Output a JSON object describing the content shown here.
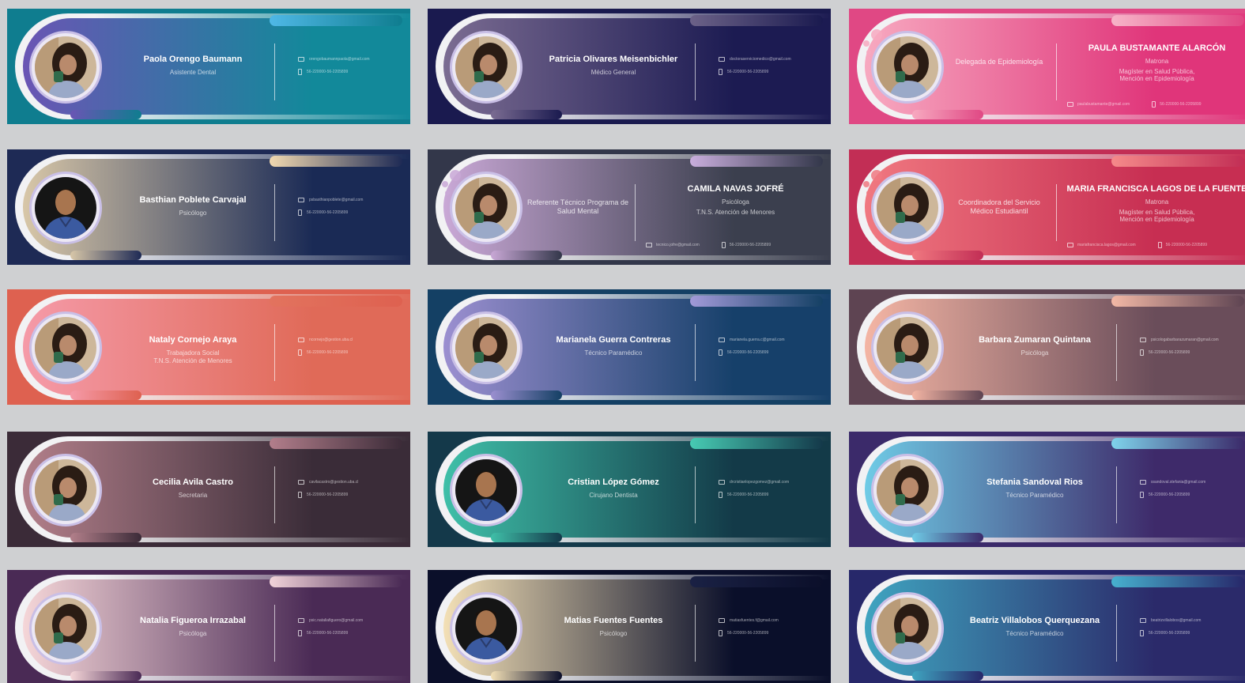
{
  "cards": [
    {
      "name": "Paola Orengo Baumann",
      "role": "Asistente Dental",
      "email": "orengobaumannpaola@gmail.com",
      "phone": "56-220000-56-2205899",
      "photo": "woman-photo",
      "colors": {
        "from": "#6a55b4",
        "to": "#12899a",
        "frame": "#0f7d8f",
        "accent": "#4fb8e6"
      }
    },
    {
      "name": "Patricia Olivares Meisenbichler",
      "role": "Médico General",
      "email": "doctoraserviciomedico@gmail.com",
      "phone": "56-220000-56-2205899",
      "photo": "woman-photo",
      "colors": {
        "from": "#7b6c92",
        "to": "#1c1b52",
        "frame": "#1a1a4f",
        "accent": "#6c6288"
      }
    },
    {
      "name": "PAULA BUSTAMANTE ALARCÓN",
      "left_title": "Delegada de Epidemiología",
      "role": "Matrona",
      "role2": "Magíster en Salud Pública, Mención en Epidemiología",
      "email": "paulabustamante@gmail.com",
      "phone": "56-220000-56-2205899",
      "photo": "woman-photo",
      "colors": {
        "from": "#f7a9c0",
        "to": "#e0357a",
        "frame": "#e04884",
        "accent": "#f7b4c8"
      }
    },
    {
      "name": "Basthian Poblete Carvajal",
      "role": "Psicólogo",
      "email": "psbasthianpoblete@gmail.com",
      "phone": "56-220000-56-2205899",
      "photo": "man-photo",
      "colors": {
        "from": "#d8c7a8",
        "to": "#1a2a55",
        "frame": "#1e2a55",
        "accent": "#f1d9b0"
      }
    },
    {
      "name": "CAMILA NAVAS JOFRÉ",
      "left_title": "Referente Técnico Programa de Salud Mental",
      "role": "Psicóloga",
      "role2": "T.N.S. Atención de Menores",
      "email": "tecnico.jofre@gmail.com",
      "phone": "56-220000-56-2205899",
      "photo": "woman-photo",
      "colors": {
        "from": "#c9a8d6",
        "to": "#3b3f4e",
        "frame": "#33374a",
        "accent": "#c9aedd"
      }
    },
    {
      "name": "MARIA FRANCISCA LAGOS DE LA FUENTE",
      "left_title": "Coordinadora del Servicio Médico Estudiantil",
      "role": "Matrona",
      "role2": "Magíster en Salud Pública, Mención en Epidemiología",
      "email": "mariafrancisca.lagos@gmail.com",
      "phone": "56-220000-56-2205899",
      "photo": "woman-photo",
      "colors": {
        "from": "#f07880",
        "to": "#c72e52",
        "frame": "#c22e55",
        "accent": "#f58a8a"
      }
    },
    {
      "name": "Nataly Cornejo Araya",
      "role": "Trabajadora Social",
      "role2": "T.N.S. Atención de Menores",
      "email": "ncornejo@gestion.uba.cl",
      "phone": "56-220000-56-2205899",
      "photo": "woman-photo",
      "colors": {
        "from": "#f59aa8",
        "to": "#e06a58",
        "frame": "#de6150",
        "accent": "#e2735e"
      }
    },
    {
      "name": "Marianela Guerra Contreras",
      "role": "Técnico Paramédico",
      "email": "marianela.guerra.c@gmail.com",
      "phone": "56-220000-56-2205899",
      "photo": "woman-photo",
      "colors": {
        "from": "#9b8fd0",
        "to": "#16406a",
        "frame": "#144064",
        "accent": "#a29ad9"
      }
    },
    {
      "name": "Barbara Zumaran Quintana",
      "role": "Psicóloga",
      "email": "psicologabarbarazumaran@gmail.com",
      "phone": "56-220000-56-2205899",
      "photo": "woman-photo",
      "colors": {
        "from": "#f4b5a4",
        "to": "#6a4d5a",
        "frame": "#5e4452",
        "accent": "#f3b8a6"
      }
    },
    {
      "name": "Cecilia Avila Castro",
      "role": "Secretaria",
      "email": "cavilacastro@gestion.uba.cl",
      "phone": "56-220000-56-2205899",
      "photo": "woman-photo",
      "colors": {
        "from": "#b27f8a",
        "to": "#3a2c38",
        "frame": "#3b2b38",
        "accent": "#b27e8b"
      }
    },
    {
      "name": "Cristian López Gómez",
      "role": "Cirujano Dentista",
      "email": "drcristianlopezgomez@gmail.com",
      "phone": "56-220000-56-2205899",
      "photo": "man-photo",
      "colors": {
        "from": "#3fbfa8",
        "to": "#133a48",
        "frame": "#14394a",
        "accent": "#47cbb3"
      }
    },
    {
      "name": "Stefania Sandoval Rios",
      "role": "Técnico Paramédico",
      "email": "ssandoval.stefania@gmail.com",
      "phone": "56-220000-56-2205899",
      "photo": "woman-photo",
      "colors": {
        "from": "#6fcbe6",
        "to": "#3e2a6a",
        "frame": "#3b2a6a",
        "accent": "#7fd3eb"
      }
    },
    {
      "name": "Natalia Figueroa Irrazabal",
      "role": "Psicóloga",
      "email": "psic.nataliafiguero@gmail.com",
      "phone": "56-220000-56-2205899",
      "photo": "woman-photo",
      "colors": {
        "from": "#f5d6d8",
        "to": "#4a2a55",
        "frame": "#4a2a55",
        "accent": "#f1d3d9"
      }
    },
    {
      "name": "Matias Fuentes Fuentes",
      "role": "Psicólogo",
      "email": "matiasfuentes.f@gmail.com",
      "phone": "56-220000-56-2205899",
      "photo": "man-photo",
      "colors": {
        "from": "#f3e0b6",
        "to": "#0a0f2a",
        "frame": "#0b0f2a",
        "accent": "#1a2144"
      }
    },
    {
      "name": "Beatriz Villalobos Querquezana",
      "role": "Técnico Paramédico",
      "email": "beatrizvillalobos@gmail.com",
      "phone": "56-220000-56-2205899",
      "photo": "woman-photo",
      "colors": {
        "from": "#3fa4c0",
        "to": "#2b2a6a",
        "frame": "#27286a",
        "accent": "#47b1cf"
      }
    }
  ]
}
